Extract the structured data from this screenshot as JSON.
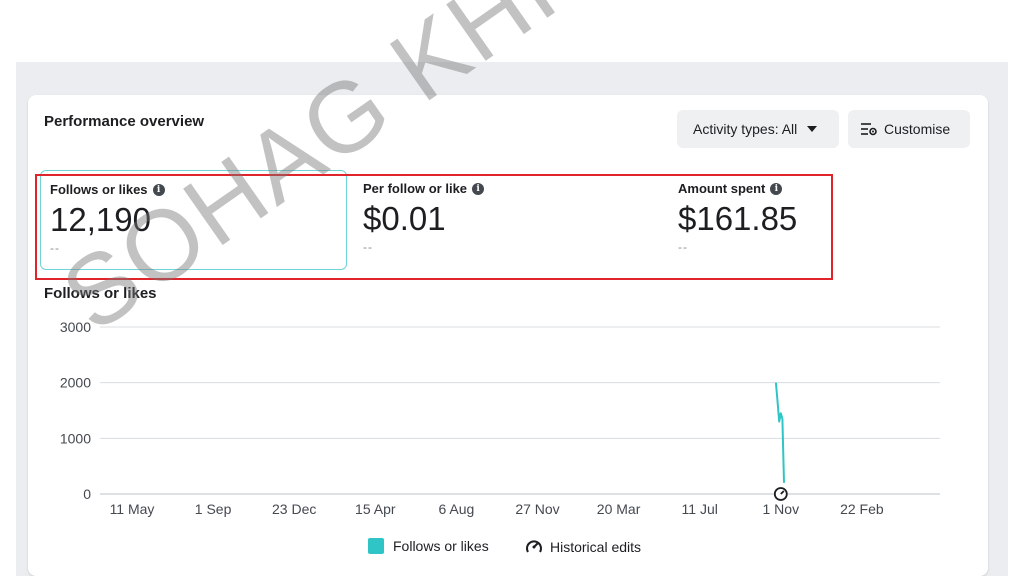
{
  "header": {
    "title": "Performance overview",
    "activity_button": "Activity types: All",
    "customise_button": "Customise"
  },
  "metrics": [
    {
      "label": "Follows or likes",
      "value": "12,190",
      "delta": "--"
    },
    {
      "label": "Per follow or like",
      "value": "$0.01",
      "delta": "--"
    },
    {
      "label": "Amount spent",
      "value": "$161.85",
      "delta": "--"
    }
  ],
  "chart_title": "Follows or likes",
  "chart_data": {
    "type": "line",
    "title": "Follows or likes",
    "xlabel": "",
    "ylabel": "",
    "ylim": [
      0,
      3000
    ],
    "yticks": [
      "3000",
      "2000",
      "1000",
      "0"
    ],
    "ytick_values": [
      3000,
      2000,
      1000,
      0
    ],
    "xticks": [
      "11 May",
      "1 Sep",
      "23 Dec",
      "15 Apr",
      "6 Aug",
      "27 Nov",
      "20 Mar",
      "11 Jul",
      "1 Nov",
      "22 Feb"
    ],
    "grid": true,
    "series": [
      {
        "name": "Follows or likes",
        "color": "#2fc5c6",
        "points": [
          {
            "tick_index": 7.94,
            "value": 2000
          },
          {
            "tick_index": 7.96,
            "value": 1650
          },
          {
            "tick_index": 7.98,
            "value": 1300
          },
          {
            "tick_index": 8.0,
            "value": 1450
          },
          {
            "tick_index": 8.02,
            "value": 1350
          },
          {
            "tick_index": 8.04,
            "value": 200
          }
        ]
      }
    ],
    "markers": [
      {
        "name": "Historical edits",
        "tick_index": 8.0,
        "icon": "gauge-icon"
      }
    ]
  },
  "legend": [
    {
      "label": "Follows or likes",
      "color": "#2fc5c6"
    },
    {
      "label": "Historical edits",
      "icon": "gauge-icon"
    }
  ],
  "watermark": "SOHAG KHISA"
}
